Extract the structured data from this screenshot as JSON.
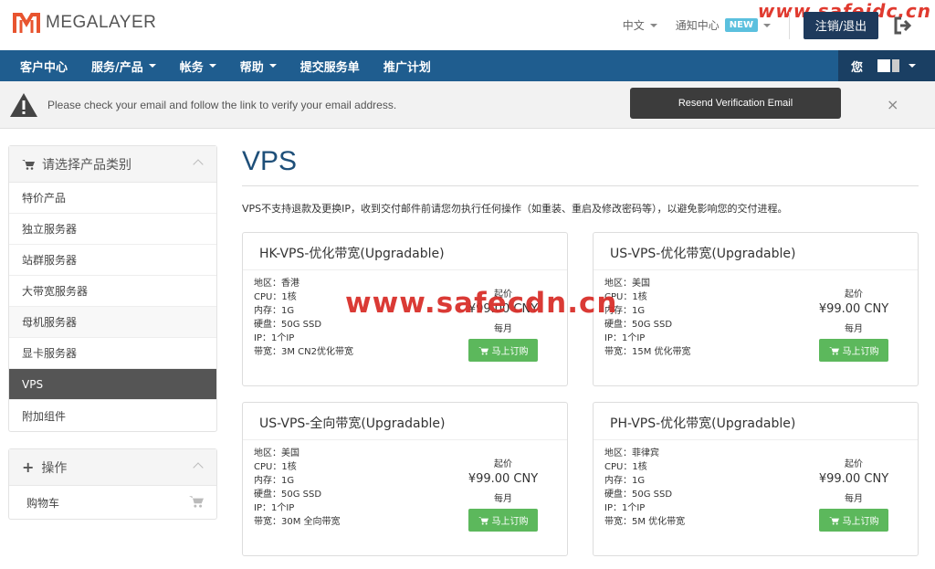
{
  "header": {
    "logo_text": "MEGALAYER",
    "language": "中文",
    "notifications": "通知中心",
    "new_badge": "NEW",
    "logout": "注销/退出",
    "watermark": "www.safeidc.cn"
  },
  "navbar": {
    "items": [
      {
        "label": "客户中心",
        "dropdown": false
      },
      {
        "label": "服务/产品",
        "dropdown": true
      },
      {
        "label": "帐务",
        "dropdown": true
      },
      {
        "label": "帮助",
        "dropdown": true
      },
      {
        "label": "提交服务单",
        "dropdown": false
      },
      {
        "label": "推广计划",
        "dropdown": false
      }
    ],
    "user_label": "您"
  },
  "alert": {
    "text": "Please check your email and follow the link to verify your email address.",
    "button": "Resend Verification Email",
    "close": "×"
  },
  "sidebar": {
    "categories_title": "请选择产品类别",
    "categories": [
      {
        "label": "特价产品",
        "state": "normal"
      },
      {
        "label": "独立服务器",
        "state": "normal"
      },
      {
        "label": "站群服务器",
        "state": "normal"
      },
      {
        "label": "大带宽服务器",
        "state": "normal"
      },
      {
        "label": "母机服务器",
        "state": "shaded"
      },
      {
        "label": "显卡服务器",
        "state": "normal"
      },
      {
        "label": "VPS",
        "state": "active"
      },
      {
        "label": "附加组件",
        "state": "normal"
      }
    ],
    "actions_title": "操作",
    "cart": "购物车"
  },
  "main": {
    "title": "VPS",
    "notice": "VPS不支持退款及更换IP，收到交付邮件前请您勿执行任何操作（如重装、重启及修改密码等），以避免影响您的交付进程。",
    "products": [
      {
        "name": "HK-VPS-优化带宽(Upgradable)",
        "specs": [
          "地区：香港",
          "CPU：1核",
          "内存：1G",
          "硬盘：50G SSD",
          "IP：1个IP",
          "带宽：3M CN2优化带宽"
        ],
        "price_from": "起价",
        "price": "¥99.00 CNY",
        "period": "每月",
        "order": "马上订购"
      },
      {
        "name": "US-VPS-优化带宽(Upgradable)",
        "specs": [
          "地区：美国",
          "CPU：1核",
          "内存：1G",
          "硬盘：50G SSD",
          "IP：1个IP",
          "带宽：15M 优化带宽"
        ],
        "price_from": "起价",
        "price": "¥99.00 CNY",
        "period": "每月",
        "order": "马上订购"
      },
      {
        "name": "US-VPS-全向带宽(Upgradable)",
        "specs": [
          "地区：美国",
          "CPU：1核",
          "内存：1G",
          "硬盘：50G SSD",
          "IP：1个IP",
          "带宽：30M 全向带宽"
        ],
        "price_from": "起价",
        "price": "¥99.00 CNY",
        "period": "每月",
        "order": "马上订购"
      },
      {
        "name": "PH-VPS-优化带宽(Upgradable)",
        "specs": [
          "地区：菲律宾",
          "CPU：1核",
          "内存：1G",
          "硬盘：50G SSD",
          "IP：1个IP",
          "带宽：5M 优化带宽"
        ],
        "price_from": "起价",
        "price": "¥99.00 CNY",
        "period": "每月",
        "order": "马上订购"
      }
    ]
  },
  "overlay_watermark": "www.safecdn.cn",
  "colors": {
    "navbar": "#1f5d8f",
    "active_item": "#555555",
    "order_button": "#5cb85c",
    "title_blue": "#1e4f79",
    "watermark_red": "#d9302b"
  }
}
